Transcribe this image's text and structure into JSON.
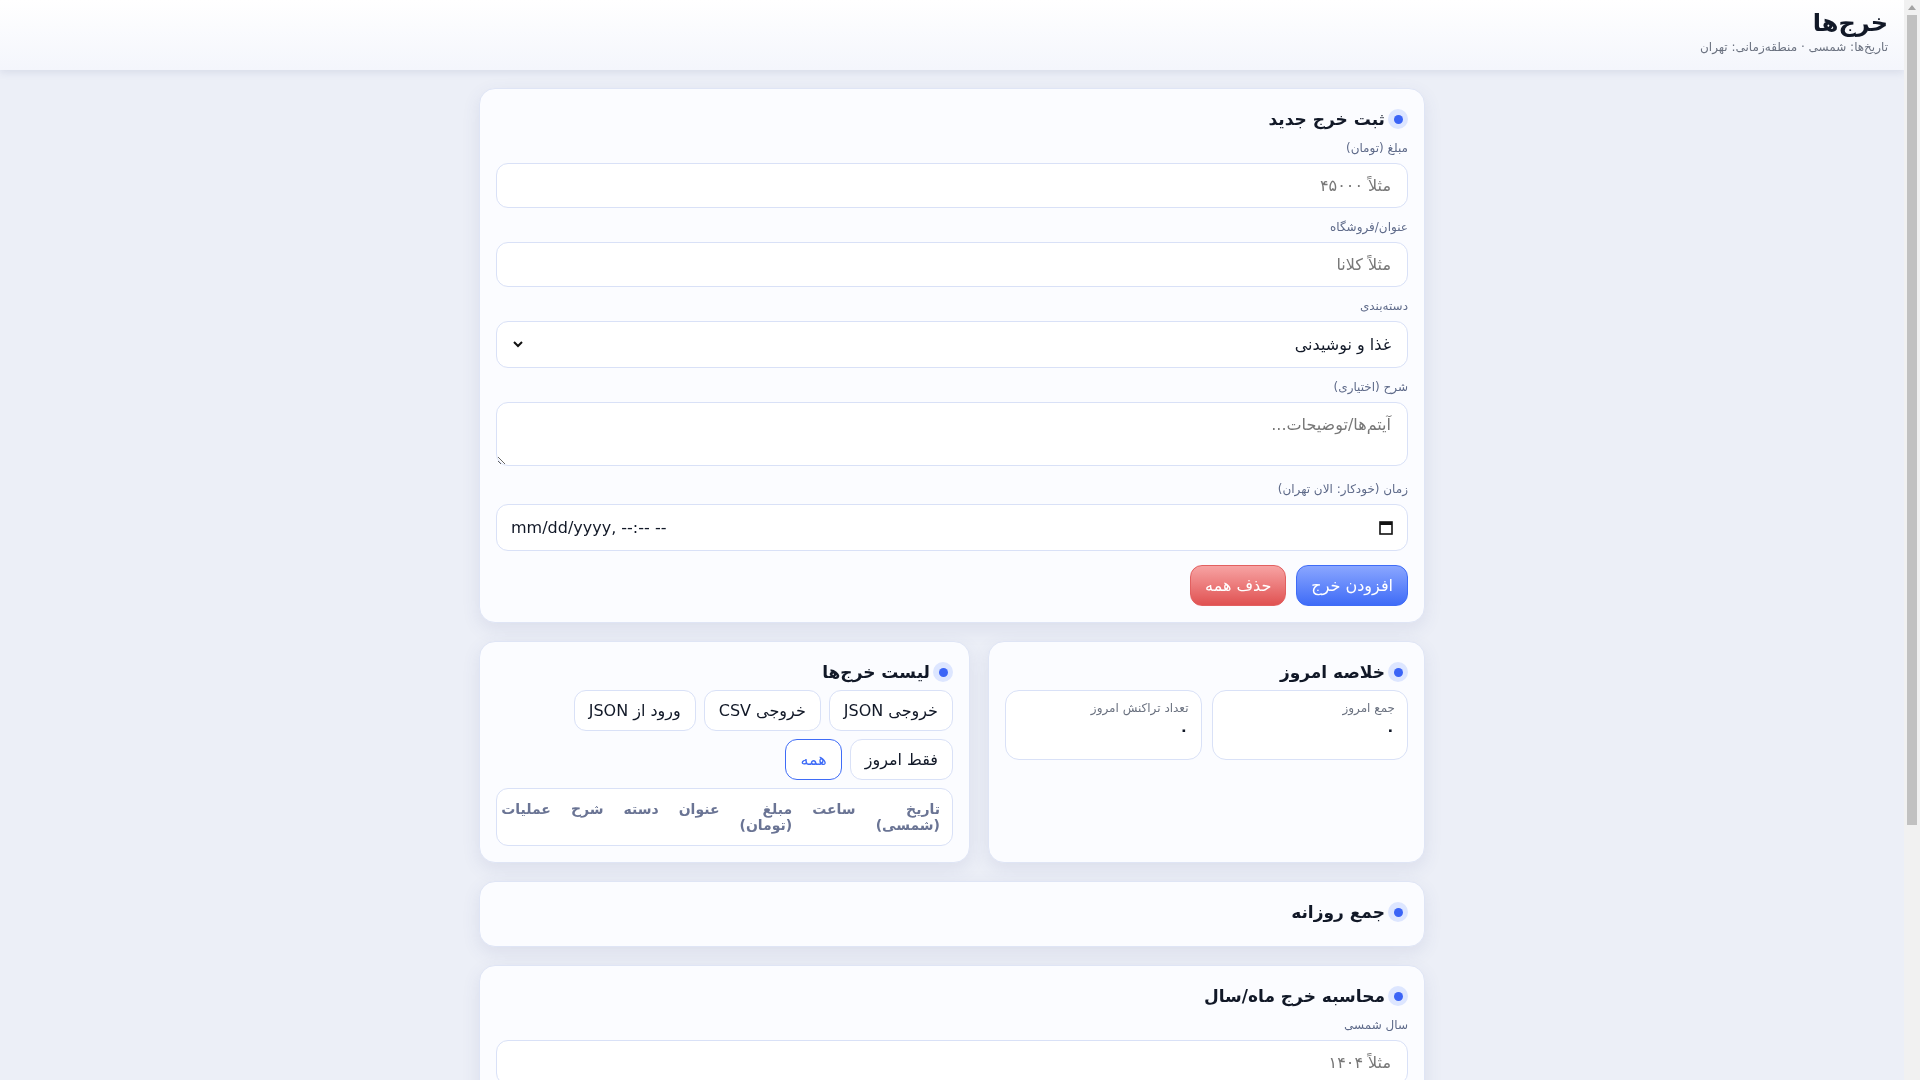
{
  "header": {
    "title": "خرج‌ها",
    "subtitle": "تاریخ‌ها: شمسی · منطقه‌زمانی: تهران"
  },
  "new_expense": {
    "title": "ثبت خرج جدید",
    "fields": [
      {
        "kind": "input",
        "label": "مبلغ (تومان)",
        "placeholder": "مثلاً ۴۵۰۰۰"
      },
      {
        "kind": "input",
        "label": "عنوان/فروشگاه",
        "placeholder": "مثلاً کلانا"
      },
      {
        "kind": "select",
        "label": "دسته‌بندی",
        "value": "غذا و نوشیدنی"
      },
      {
        "kind": "textarea",
        "label": "شرح (اختیاری)",
        "placeholder": "آیتم‌ها/توضیحات..."
      },
      {
        "kind": "datetime",
        "label": "زمان (خودکار: الان تهران)",
        "value": "mm/dd/yyyy, --:-- --"
      }
    ],
    "buttons": [
      {
        "kind": "primary",
        "label": "افزودن خرج"
      },
      {
        "kind": "danger",
        "label": "حذف همه"
      }
    ]
  },
  "today_summary": {
    "title": "خلاصه امروز",
    "stats": [
      {
        "label": "جمع امروز",
        "value": "۰"
      },
      {
        "label": "تعداد تراکنش امروز",
        "value": "۰"
      }
    ]
  },
  "expense_list": {
    "title": "لیست خرج‌ها",
    "actions": [
      "خروجی JSON",
      "خروجی CSV",
      "ورود از JSON"
    ],
    "filters": [
      {
        "label": "فقط امروز",
        "selected": false
      },
      {
        "label": "همه",
        "selected": true
      }
    ],
    "table": {
      "columns": [
        "تاریخ (شمسی)",
        "ساعت",
        "مبلغ (تومان)",
        "عنوان",
        "دسته",
        "شرح",
        "عملیات"
      ]
    }
  },
  "daily_totals": {
    "title": "جمع روزانه"
  },
  "monthly_calc": {
    "title": "محاسبه خرج ماه/سال",
    "fields": [
      {
        "kind": "input",
        "label": "سال شمسی",
        "placeholder": "مثلاً ۱۴۰۴"
      }
    ]
  }
}
